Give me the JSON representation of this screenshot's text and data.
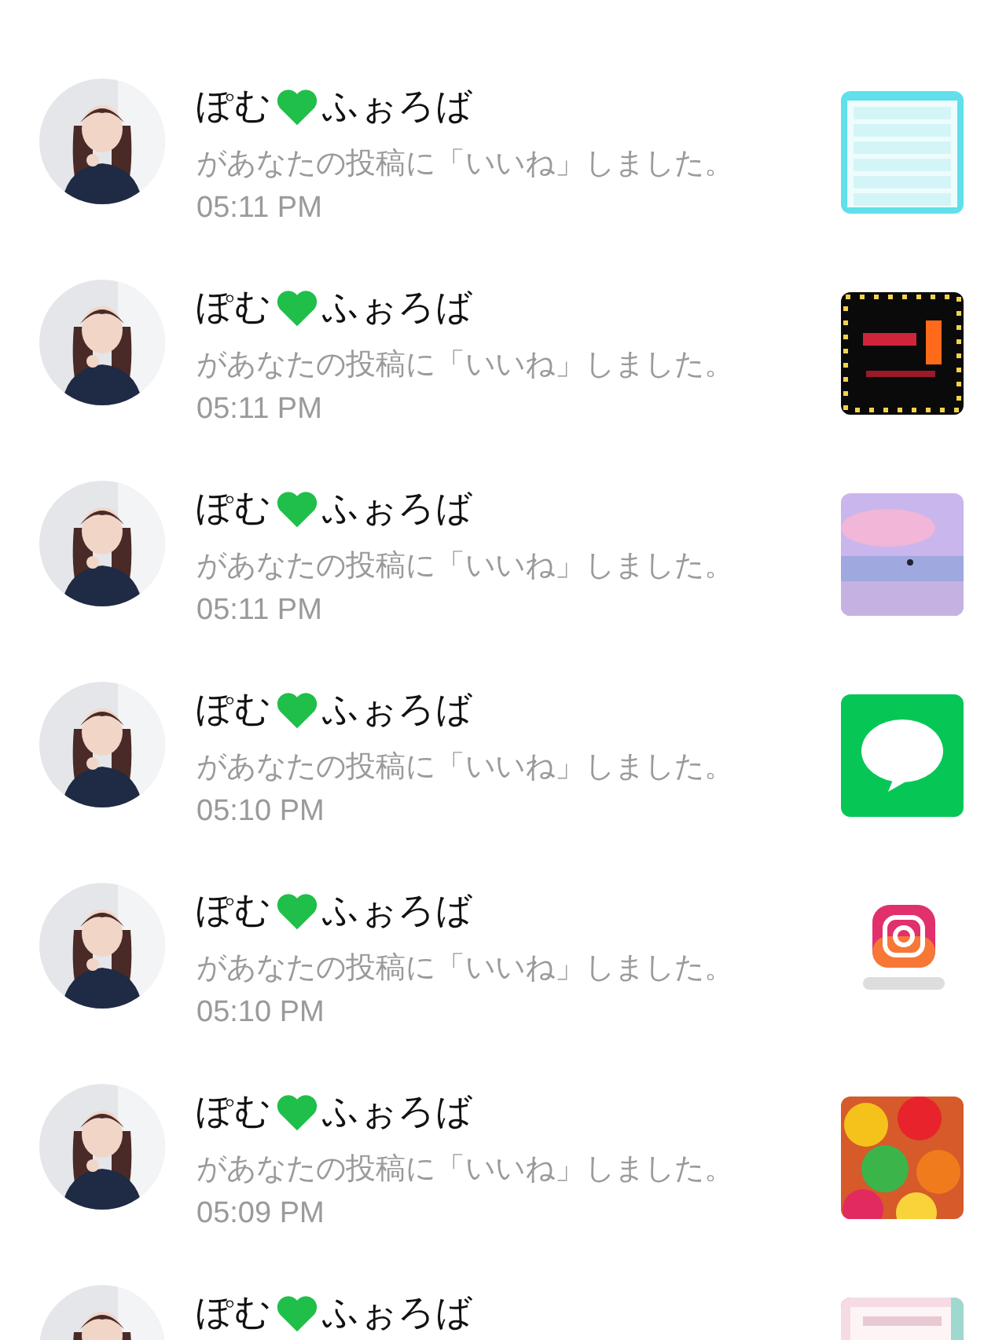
{
  "notifications": [
    {
      "name_start": "ぽむ",
      "name_end": "ふぉろば",
      "message": "があなたの投稿に「いいね」しました。",
      "time": "05:11 PM"
    },
    {
      "name_start": "ぽむ",
      "name_end": "ふぉろば",
      "message": "があなたの投稿に「いいね」しました。",
      "time": "05:11 PM"
    },
    {
      "name_start": "ぽむ",
      "name_end": "ふぉろば",
      "message": "があなたの投稿に「いいね」しました。",
      "time": "05:11 PM"
    },
    {
      "name_start": "ぽむ",
      "name_end": "ふぉろば",
      "message": "があなたの投稿に「いいね」しました。",
      "time": "05:10 PM"
    },
    {
      "name_start": "ぽむ",
      "name_end": "ふぉろば",
      "message": "があなたの投稿に「いいね」しました。",
      "time": "05:10 PM"
    },
    {
      "name_start": "ぽむ",
      "name_end": "ふぉろば",
      "message": "があなたの投稿に「いいね」しました。",
      "time": "05:09 PM"
    },
    {
      "name_start": "ぽむ",
      "name_end": "ふぉろば"
    }
  ]
}
